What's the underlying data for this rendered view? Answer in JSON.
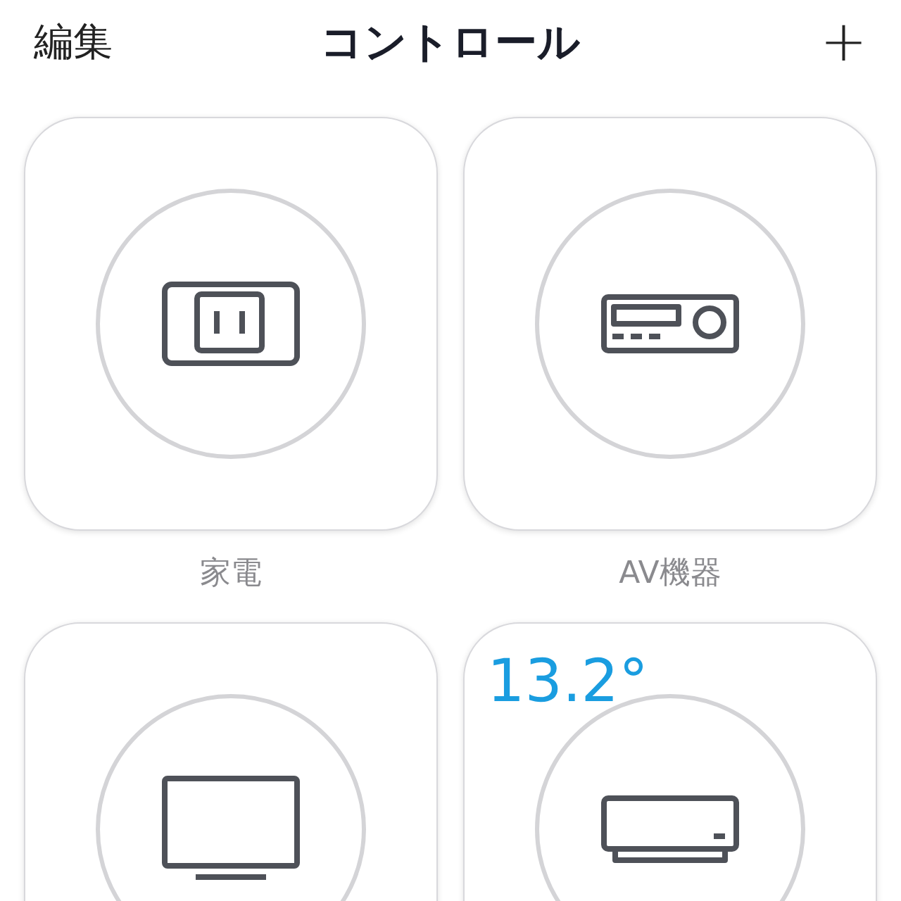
{
  "header": {
    "edit": "編集",
    "title": "コントロール",
    "add": "+"
  },
  "tiles": [
    {
      "kind": "outlet",
      "label": "家電"
    },
    {
      "kind": "receiver",
      "label": "AV機器"
    },
    {
      "kind": "tv"
    },
    {
      "kind": "aircon",
      "reading": "13.2°"
    }
  ]
}
